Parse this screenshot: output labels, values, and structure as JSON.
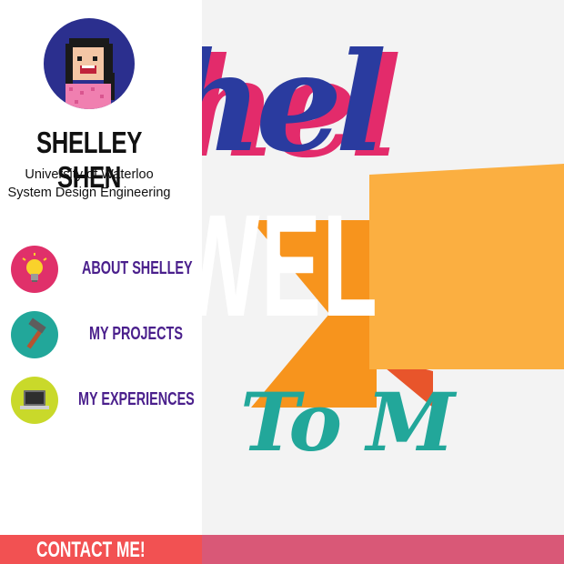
{
  "profile": {
    "name": "SHELLEY SHEN",
    "school": "University of Waterloo",
    "program": "System Design Engineering"
  },
  "nav": {
    "items": [
      {
        "label": "ABOUT SHELLEY",
        "icon": "lightbulb-icon",
        "color": "#e0306a"
      },
      {
        "label": "MY PROJECTS",
        "icon": "hammer-icon",
        "color": "#22a79a"
      },
      {
        "label": "MY EXPERIENCES",
        "icon": "laptop-icon",
        "color": "#c9d92a"
      }
    ]
  },
  "hero": {
    "line1": "hel",
    "line2": "WEL",
    "line3": "To M"
  },
  "footer": {
    "contact_label": "CONTACT ME!"
  },
  "colors": {
    "nav_text": "#4a1f8c",
    "contact_bg": "#f25152",
    "footer_bg": "#d95877",
    "hero_blue": "#2a3b9f",
    "hero_pink": "#e32b6b",
    "ribbon_orange": "#f7941d",
    "banner_yellow": "#fbaf41",
    "hero_teal": "#22a79a"
  }
}
